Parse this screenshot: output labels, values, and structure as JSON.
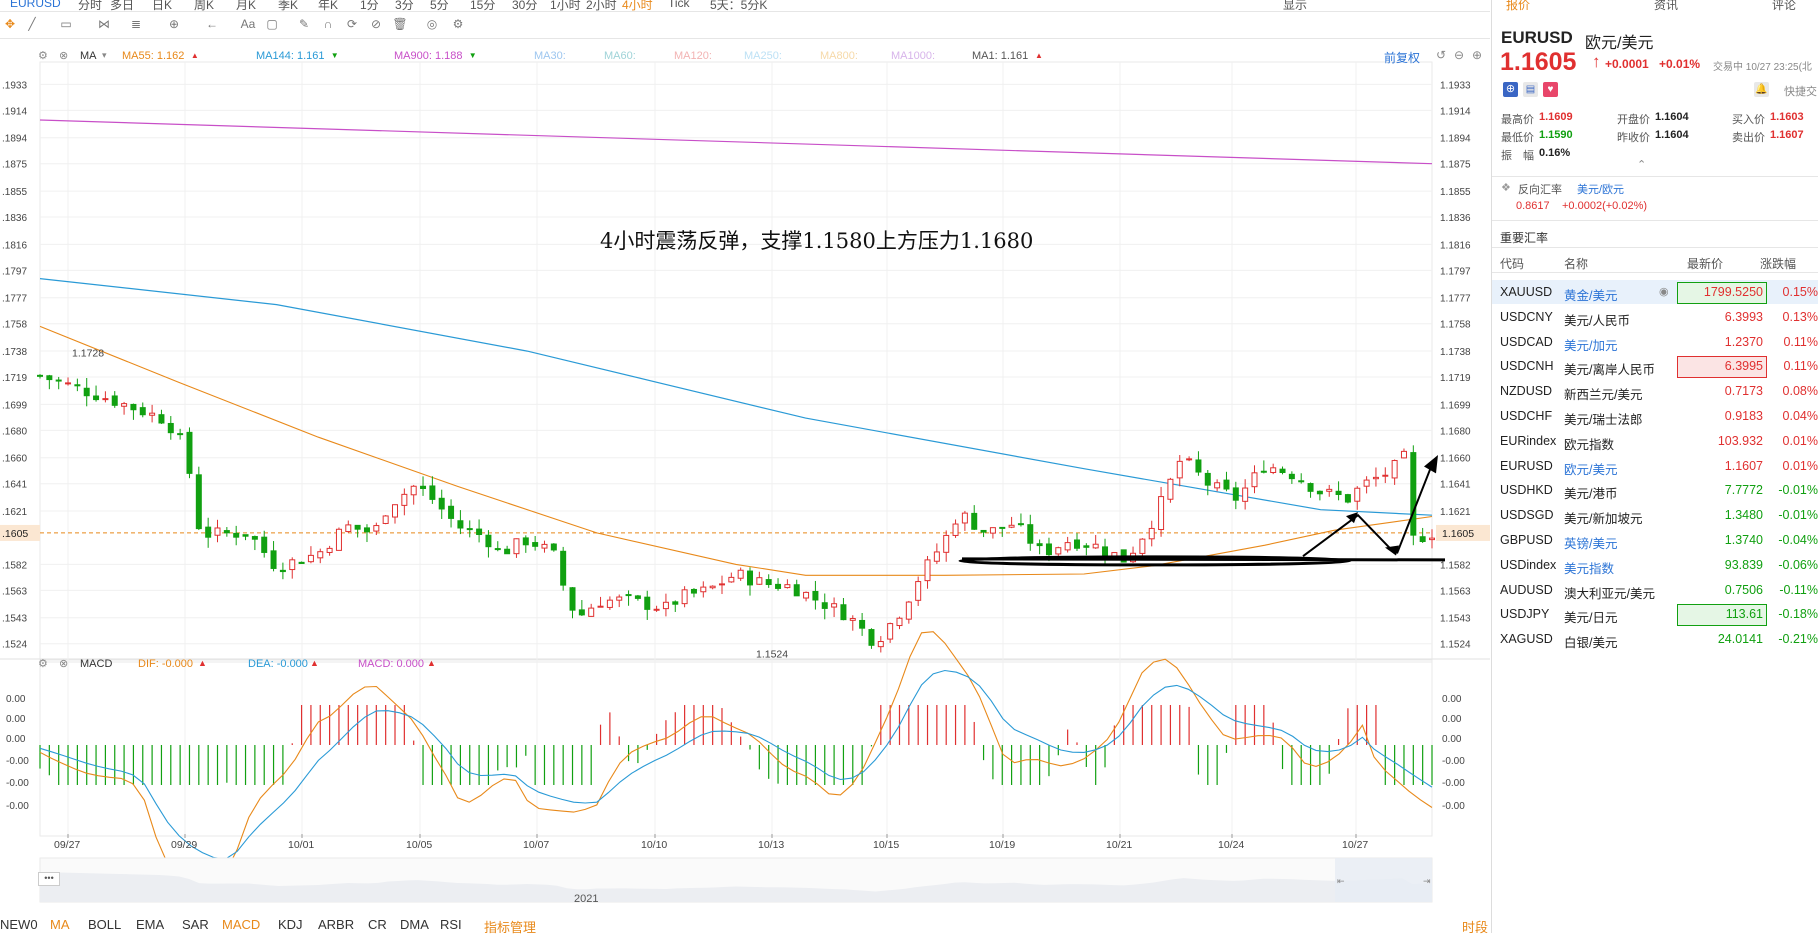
{
  "toolbar": {
    "symbol": "EURUSD",
    "periods": [
      "分时",
      "多日",
      "日K",
      "周K",
      "月K",
      "季K",
      "年K",
      "1分",
      "3分",
      "5分",
      "15分",
      "30分",
      "1小时",
      "2小时",
      "4小时",
      "Tick",
      "5天：5分K"
    ],
    "active_period": "4小时",
    "right_items": [
      "显示"
    ]
  },
  "indicator_bar": {
    "ma_label": "MA",
    "items": [
      {
        "text": "MA55: 1.162",
        "color": "#e8891a",
        "arrow": "up"
      },
      {
        "text": "MA144: 1.161",
        "color": "#2a9ad6",
        "arrow": "down"
      },
      {
        "text": "MA900: 1.188",
        "color": "#c84fc8",
        "arrow": "down"
      },
      {
        "text": "MA30:",
        "color": "#9dc6ef",
        "arrow": ""
      },
      {
        "text": "MA60:",
        "color": "#9fd3d8",
        "arrow": ""
      },
      {
        "text": "MA120:",
        "color": "#f2b3b3",
        "arrow": ""
      },
      {
        "text": "MA250:",
        "color": "#bde1f5",
        "arrow": ""
      },
      {
        "text": "MA800:",
        "color": "#f6d9a8",
        "arrow": ""
      },
      {
        "text": "MA1000:",
        "color": "#d7b4ea",
        "arrow": ""
      },
      {
        "text": "MA1: 1.161",
        "color": "#555555",
        "arrow": "up"
      }
    ],
    "adjust_label": "前复权"
  },
  "annotation": "4小时震荡反弹，支撑1.1580上方压力1.1680",
  "price_axis_left": [
    ".1933",
    ".1914",
    ".1894",
    ".1875",
    ".1855",
    ".1836",
    ".1816",
    ".1797",
    ".1777",
    ".1758",
    ".1738",
    ".1719",
    ".1699",
    ".1680",
    ".1660",
    ".1641",
    ".1621",
    ".1605",
    ".1582",
    ".1563",
    ".1543",
    ".1524"
  ],
  "price_axis_right": [
    "1.1933",
    "1.1914",
    "1.1894",
    "1.1875",
    "1.1855",
    "1.1836",
    "1.1816",
    "1.1797",
    "1.1777",
    "1.1758",
    "1.1738",
    "1.1719",
    "1.1699",
    "1.1680",
    "1.1660",
    "1.1641",
    "1.1621",
    "1.1605",
    "1.1582",
    "1.1563",
    "1.1543",
    "1.1524"
  ],
  "high_label": "1.1728",
  "low_label": "1.1524",
  "current_price_tag": "1.1605",
  "macd_bar": {
    "label": "MACD",
    "dif": "DIF: -0.000",
    "dea": "DEA: -0.000",
    "macd": "MACD: 0.000"
  },
  "macd_axis": [
    "0.00",
    "0.00",
    "0.00",
    "-0.00",
    "-0.00",
    "-0.00"
  ],
  "date_axis": [
    "09/27",
    "09/29",
    "10/01",
    "10/05",
    "10/07",
    "10/10",
    "10/13",
    "10/15",
    "10/19",
    "10/21",
    "10/24",
    "10/27"
  ],
  "navigator_year": "2021",
  "navigator_menu": "•••",
  "bottom_tabs": [
    "NEW0",
    "MA",
    "BOLL",
    "EMA",
    "SAR",
    "MACD",
    "KDJ",
    "ARBR",
    "CR",
    "DMA",
    "RSI",
    "指标管理"
  ],
  "bottom_right": "时段",
  "chart_data": {
    "type": "candlestick",
    "price_range": [
      1.1515,
      1.1945
    ],
    "ma900": [
      [
        0,
        1.1907
      ],
      [
        1,
        1.1875
      ]
    ],
    "ma144": [
      [
        0,
        1.1791
      ],
      [
        0.17,
        1.1772
      ],
      [
        0.35,
        1.1738
      ],
      [
        0.55,
        1.1689
      ],
      [
        0.75,
        1.1652
      ],
      [
        0.92,
        1.1622
      ],
      [
        1,
        1.1618
      ]
    ],
    "ma55": [
      [
        0,
        1.1756
      ],
      [
        0.1,
        1.1715
      ],
      [
        0.2,
        1.1675
      ],
      [
        0.3,
        1.1639
      ],
      [
        0.4,
        1.1605
      ],
      [
        0.5,
        1.1582
      ],
      [
        0.55,
        1.1574
      ],
      [
        0.65,
        1.1574
      ],
      [
        0.75,
        1.1575
      ],
      [
        0.8,
        1.1581
      ],
      [
        0.88,
        1.1596
      ],
      [
        0.93,
        1.1607
      ],
      [
        1,
        1.1617
      ]
    ],
    "close_path": [
      [
        0,
        1.172
      ],
      [
        0.05,
        1.1703
      ],
      [
        0.09,
        1.1688
      ],
      [
        0.1,
        1.1675
      ],
      [
        0.11,
        1.164
      ],
      [
        0.115,
        1.1604
      ],
      [
        0.15,
        1.1605
      ],
      [
        0.17,
        1.158
      ],
      [
        0.2,
        1.159
      ],
      [
        0.22,
        1.161
      ],
      [
        0.24,
        1.1605
      ],
      [
        0.25,
        1.1625
      ],
      [
        0.27,
        1.164
      ],
      [
        0.28,
        1.1632
      ],
      [
        0.3,
        1.161
      ],
      [
        0.32,
        1.1602
      ],
      [
        0.33,
        1.159
      ],
      [
        0.35,
        1.16
      ],
      [
        0.36,
        1.1595
      ],
      [
        0.37,
        1.1588
      ],
      [
        0.38,
        1.1552
      ],
      [
        0.39,
        1.1545
      ],
      [
        0.4,
        1.1555
      ],
      [
        0.42,
        1.1556
      ],
      [
        0.45,
        1.155
      ],
      [
        0.46,
        1.1558
      ],
      [
        0.48,
        1.1563
      ],
      [
        0.5,
        1.1575
      ],
      [
        0.52,
        1.1568
      ],
      [
        0.54,
        1.1566
      ],
      [
        0.56,
        1.1555
      ],
      [
        0.58,
        1.1545
      ],
      [
        0.6,
        1.1525
      ],
      [
        0.62,
        1.155
      ],
      [
        0.63,
        1.157
      ],
      [
        0.65,
        1.16
      ],
      [
        0.66,
        1.162
      ],
      [
        0.68,
        1.1605
      ],
      [
        0.7,
        1.1612
      ],
      [
        0.72,
        1.159
      ],
      [
        0.74,
        1.16
      ],
      [
        0.76,
        1.1595
      ],
      [
        0.78,
        1.1585
      ],
      [
        0.8,
        1.1615
      ],
      [
        0.82,
        1.166
      ],
      [
        0.84,
        1.164
      ],
      [
        0.86,
        1.163
      ],
      [
        0.88,
        1.1655
      ],
      [
        0.9,
        1.1648
      ],
      [
        0.92,
        1.1635
      ],
      [
        0.94,
        1.163
      ],
      [
        0.95,
        1.164
      ],
      [
        0.97,
        1.165
      ],
      [
        0.98,
        1.166
      ],
      [
        0.985,
        1.16
      ],
      [
        1,
        1.1605
      ]
    ],
    "drawn_box_price": [
      1.1582,
      1.159
    ],
    "arrows": "black trend arrows drawn on chart"
  },
  "panel": {
    "tabs": [
      "报价",
      "资讯",
      "评论"
    ],
    "symbol": "EURUSD",
    "name": "欧元/美元",
    "price": "1.1605",
    "change": "+0.0001",
    "change_pct": "+0.01%",
    "trade_time": "交易中 10/27 23:25(北",
    "quick_trade": "快捷交",
    "stats": [
      {
        "label": "最高价",
        "value": "1.1609",
        "color": "red"
      },
      {
        "label": "开盘价",
        "value": "1.1604",
        "color": "dark"
      },
      {
        "label": "买入价",
        "value": "1.1603",
        "color": "red"
      },
      {
        "label": "最低价",
        "value": "1.1590",
        "color": "green"
      },
      {
        "label": "昨收价",
        "value": "1.1604",
        "color": "dark"
      },
      {
        "label": "卖出价",
        "value": "1.1607",
        "color": "red"
      },
      {
        "label": "振　幅",
        "value": "0.16%",
        "color": "dark"
      }
    ],
    "reverse_label": "反向汇率",
    "reverse_pair": "美元/欧元",
    "reverse_price": "0.8617",
    "reverse_change": "+0.0002(+0.02%)",
    "section_title": "重要汇率",
    "table_headers": [
      "代码",
      "名称",
      "最新价",
      "涨跌幅"
    ],
    "rows": [
      {
        "code": "XAUUSD",
        "name": "黄金/美元",
        "price": "1799.5250",
        "pct": "0.15%",
        "up": true,
        "highlight": "green",
        "name_link": true,
        "selected": true
      },
      {
        "code": "USDCNY",
        "name": "美元/人民币",
        "price": "6.3993",
        "pct": "0.13%",
        "up": true,
        "highlight": "",
        "name_link": false
      },
      {
        "code": "USDCAD",
        "name": "美元/加元",
        "price": "1.2370",
        "pct": "0.11%",
        "up": true,
        "highlight": "",
        "name_link": true
      },
      {
        "code": "USDCNH",
        "name": "美元/离岸人民币",
        "price": "6.3995",
        "pct": "0.11%",
        "up": true,
        "highlight": "red",
        "name_link": false
      },
      {
        "code": "NZDUSD",
        "name": "新西兰元/美元",
        "price": "0.7173",
        "pct": "0.08%",
        "up": true,
        "highlight": "",
        "name_link": false
      },
      {
        "code": "USDCHF",
        "name": "美元/瑞士法郎",
        "price": "0.9183",
        "pct": "0.04%",
        "up": true,
        "highlight": "",
        "name_link": false
      },
      {
        "code": "EURindex",
        "name": "欧元指数",
        "price": "103.932",
        "pct": "0.01%",
        "up": true,
        "highlight": "",
        "name_link": false
      },
      {
        "code": "EURUSD",
        "name": "欧元/美元",
        "price": "1.1607",
        "pct": "0.01%",
        "up": true,
        "highlight": "",
        "name_link": true
      },
      {
        "code": "USDHKD",
        "name": "美元/港币",
        "price": "7.7772",
        "pct": "-0.01%",
        "up": false,
        "highlight": "",
        "name_link": false
      },
      {
        "code": "USDSGD",
        "name": "美元/新加坡元",
        "price": "1.3480",
        "pct": "-0.01%",
        "up": false,
        "highlight": "",
        "name_link": false
      },
      {
        "code": "GBPUSD",
        "name": "英镑/美元",
        "price": "1.3740",
        "pct": "-0.04%",
        "up": false,
        "highlight": "",
        "name_link": true
      },
      {
        "code": "USDindex",
        "name": "美元指数",
        "price": "93.839",
        "pct": "-0.06%",
        "up": false,
        "highlight": "",
        "name_link": true
      },
      {
        "code": "AUDUSD",
        "name": "澳大利亚元/美元",
        "price": "0.7506",
        "pct": "-0.11%",
        "up": false,
        "highlight": "",
        "name_link": false
      },
      {
        "code": "USDJPY",
        "name": "美元/日元",
        "price": "113.61",
        "pct": "-0.18%",
        "up": false,
        "highlight": "green",
        "name_link": false
      },
      {
        "code": "XAGUSD",
        "name": "白银/美元",
        "price": "24.0141",
        "pct": "-0.21%",
        "up": false,
        "highlight": "",
        "name_link": false
      }
    ]
  }
}
